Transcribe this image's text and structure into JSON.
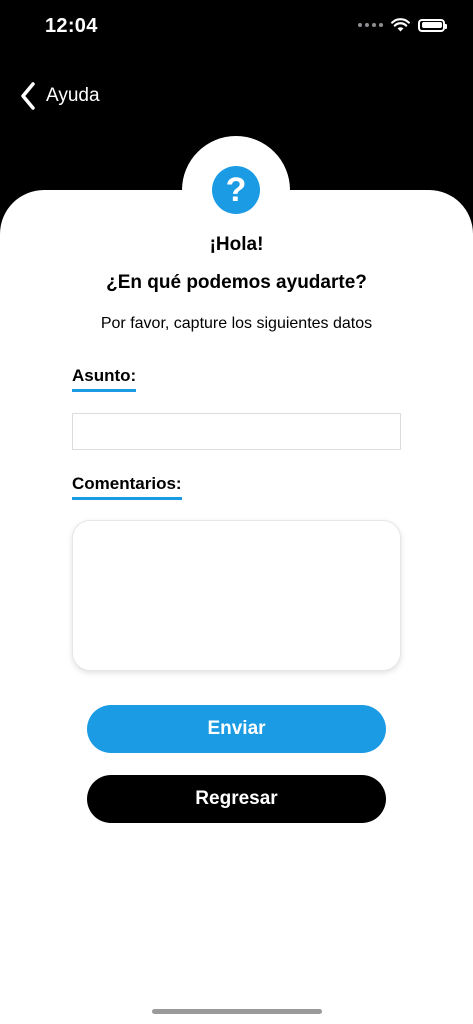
{
  "status_bar": {
    "time": "12:04"
  },
  "nav": {
    "back_label": "Ayuda"
  },
  "header": {
    "icon": "question-mark-icon",
    "icon_glyph": "?",
    "greeting": "¡Hola!",
    "question": "¿En qué podemos ayudarte?",
    "instruction": "Por favor, capture los siguientes datos"
  },
  "form": {
    "subject_label": "Asunto:",
    "subject_value": "",
    "subject_placeholder": "",
    "comments_label": "Comentarios:",
    "comments_value": "",
    "comments_placeholder": ""
  },
  "buttons": {
    "send_label": "Enviar",
    "back_label": "Regresar"
  },
  "colors": {
    "accent": "#1a9be3",
    "header_background": "#000000",
    "secondary_button": "#000000"
  }
}
